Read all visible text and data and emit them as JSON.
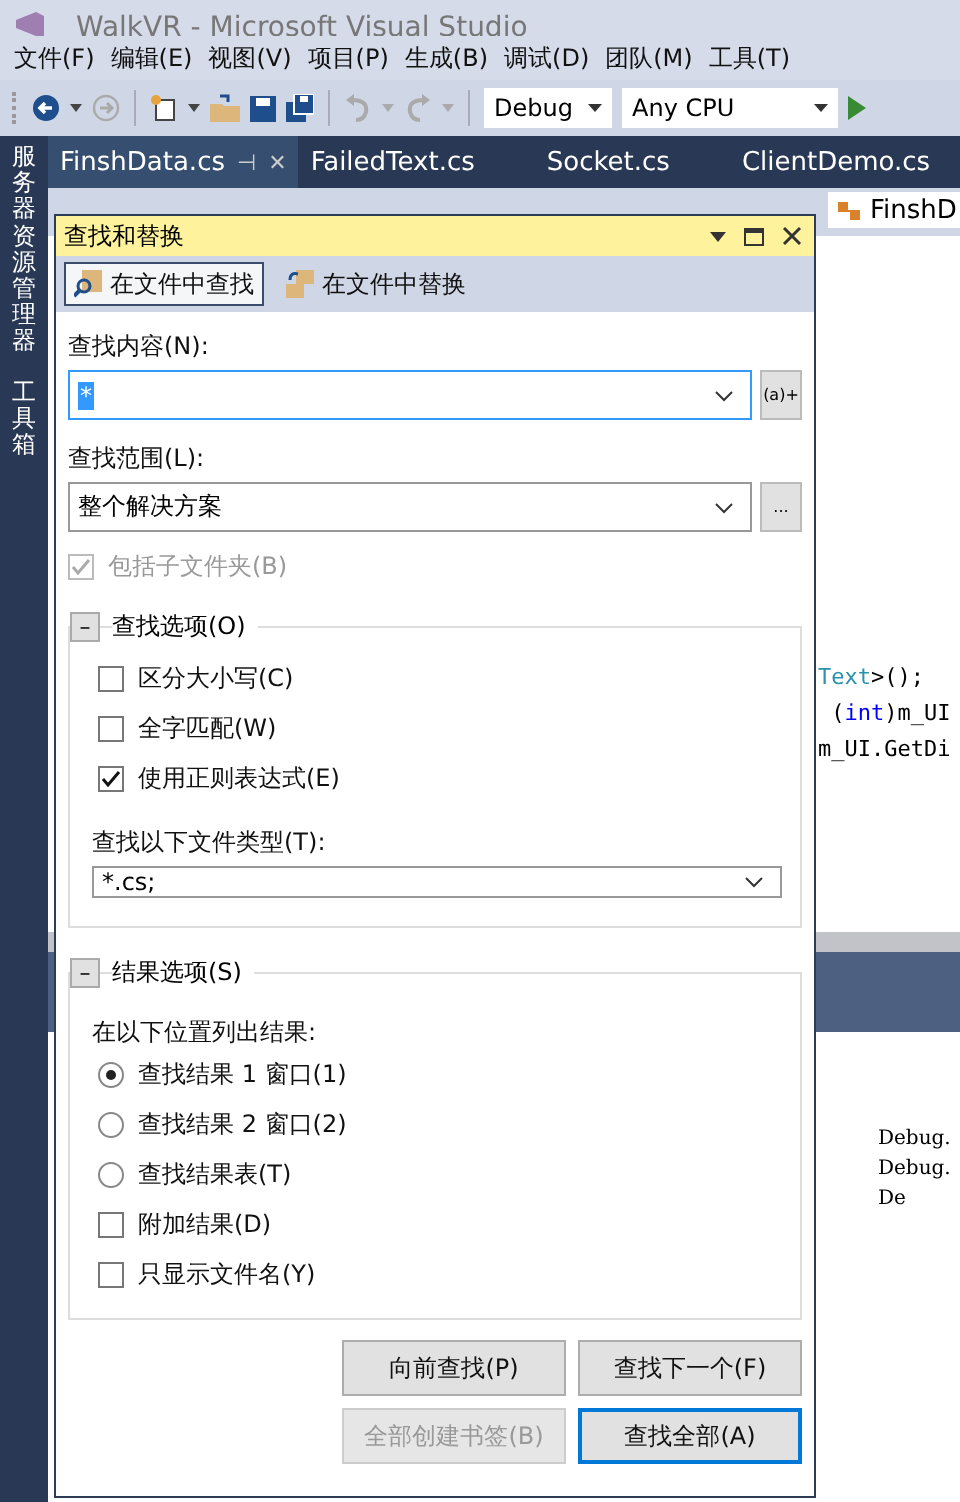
{
  "window": {
    "title": "WalkVR - Microsoft Visual Studio"
  },
  "menu": [
    "文件(F)",
    "编辑(E)",
    "视图(V)",
    "项目(P)",
    "生成(B)",
    "调试(D)",
    "团队(M)",
    "工具(T)"
  ],
  "toolbar": {
    "configuration": "Debug",
    "platform": "Any CPU"
  },
  "side_tabs": [
    "服务器资源管理器",
    "工具箱"
  ],
  "doc_tabs": [
    {
      "label": "FinshData.cs",
      "selected": true,
      "pin": "⊣",
      "close": "✕"
    },
    {
      "label": "FailedText.cs",
      "selected": false
    },
    {
      "label": "Socket.cs",
      "selected": false
    },
    {
      "label": "ClientDemo.cs",
      "selected": false
    }
  ],
  "navigation_bar": {
    "member": "FinshD"
  },
  "code_lines": [
    [
      {
        "kind": "type",
        "text": "Text"
      },
      {
        "kind": "plain",
        "text": ">();"
      }
    ],
    [
      {
        "kind": "plain",
        "text": " ("
      },
      {
        "kind": "keyword",
        "text": "int"
      },
      {
        "kind": "plain",
        "text": ")m_UI"
      }
    ],
    [
      {
        "kind": "plain",
        "text": "m_UI.GetDi"
      }
    ]
  ],
  "output_lines": [
    "Debug.",
    "Debug.",
    "De"
  ],
  "dialog": {
    "title": "查找和替换",
    "modes": [
      {
        "label": "在文件中查找",
        "selected": true
      },
      {
        "label": "在文件中替换",
        "selected": false
      }
    ],
    "find_label": "查找内容(N):",
    "find_value": "*",
    "regex_button": "(a)+",
    "scope_label": "查找范围(L):",
    "scope_value": "整个解决方案",
    "browse_button": "...",
    "include_subfolders": {
      "label": "包括子文件夹(B)",
      "checked": true,
      "disabled": true
    },
    "find_options": {
      "collapse": "–",
      "title": "查找选项(O)",
      "expanded": true,
      "options": [
        {
          "label": "区分大小写(C)",
          "checked": false
        },
        {
          "label": "全字匹配(W)",
          "checked": false
        },
        {
          "label": "使用正则表达式(E)",
          "checked": true
        }
      ],
      "file_types_label": "查找以下文件类型(T):",
      "file_types_value": "*.cs;"
    },
    "result_options": {
      "collapse": "–",
      "title": "结果选项(S)",
      "expanded": true,
      "list_label": "在以下位置列出结果:",
      "items": [
        {
          "kind": "radio",
          "label": "查找结果 1 窗口(1)",
          "selected": true
        },
        {
          "kind": "radio",
          "label": "查找结果 2 窗口(2)",
          "selected": false
        },
        {
          "kind": "radio",
          "label": "查找结果表(T)",
          "selected": false
        },
        {
          "kind": "checkbox",
          "label": "附加结果(D)",
          "checked": false
        },
        {
          "kind": "checkbox",
          "label": "只显示文件名(Y)",
          "checked": false
        }
      ]
    },
    "buttons": [
      {
        "label": "向前查找(P)",
        "disabled": false,
        "default": false
      },
      {
        "label": "查找下一个(F)",
        "disabled": false,
        "default": false
      },
      {
        "label": "全部创建书签(B)",
        "disabled": true,
        "default": false
      },
      {
        "label": "查找全部(A)",
        "disabled": false,
        "default": true
      }
    ]
  }
}
